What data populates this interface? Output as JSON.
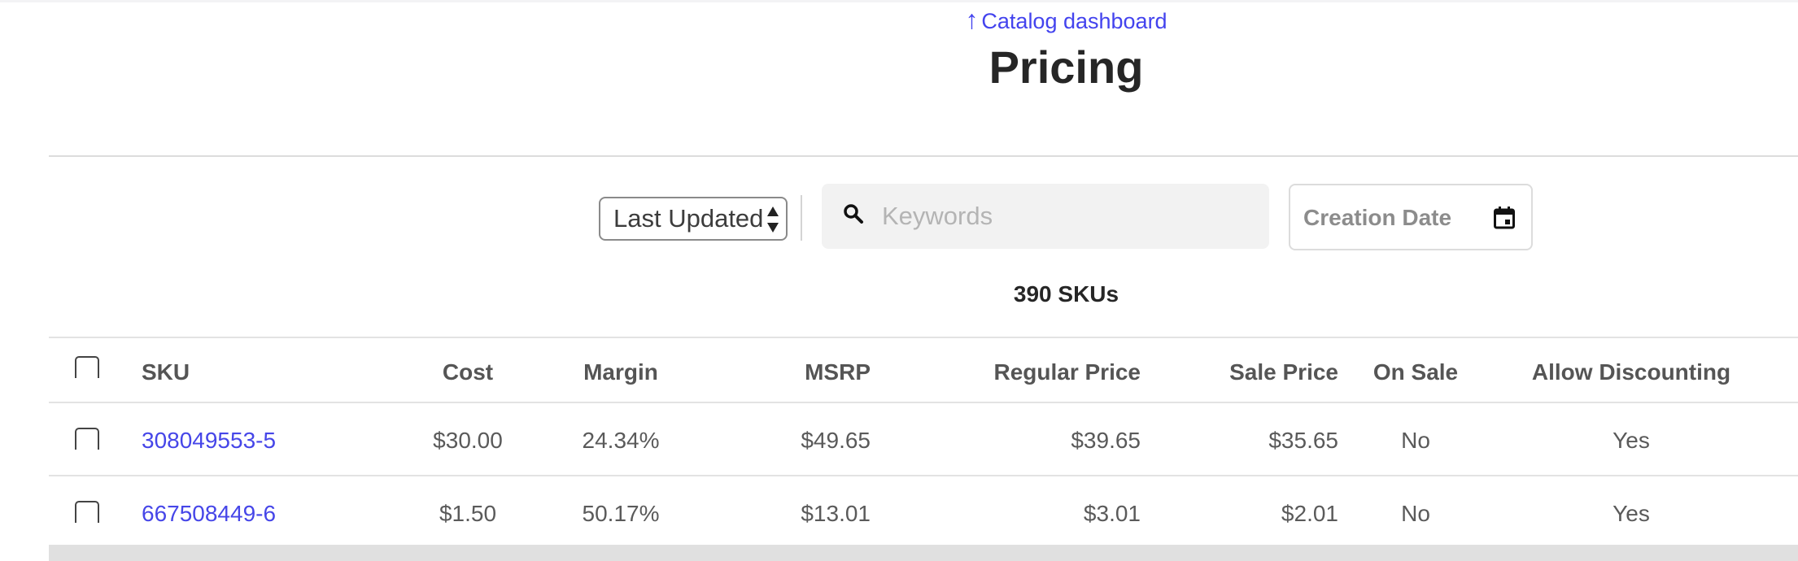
{
  "nav": {
    "back_arrow": "↑",
    "back_label": "Catalog dashboard"
  },
  "page": {
    "title": "Pricing",
    "count_label": "390 SKUs"
  },
  "filters": {
    "sort": {
      "selected": "Last Updated"
    },
    "search": {
      "placeholder": "Keywords",
      "value": ""
    },
    "date": {
      "label": "Creation Date"
    }
  },
  "icons": {
    "search": "search-icon",
    "calendar": "calendar-icon",
    "sort_arrows": "sort-arrows-icon"
  },
  "colors": {
    "link": "#4646e8",
    "title": "#262626",
    "search_bg": "#f2f2f2"
  },
  "table": {
    "columns": [
      "SKU",
      "Cost",
      "Margin",
      "MSRP",
      "Regular Price",
      "Sale Price",
      "On Sale",
      "Allow Discounting"
    ],
    "rows": [
      {
        "sku": "308049553-5",
        "cost": "$30.00",
        "margin": "24.34%",
        "msrp": "$49.65",
        "regular_price": "$39.65",
        "sale_price": "$35.65",
        "on_sale": "No",
        "allow_discounting": "Yes"
      },
      {
        "sku": "667508449-6",
        "cost": "$1.50",
        "margin": "50.17%",
        "msrp": "$13.01",
        "regular_price": "$3.01",
        "sale_price": "$2.01",
        "on_sale": "No",
        "allow_discounting": "Yes"
      }
    ]
  }
}
